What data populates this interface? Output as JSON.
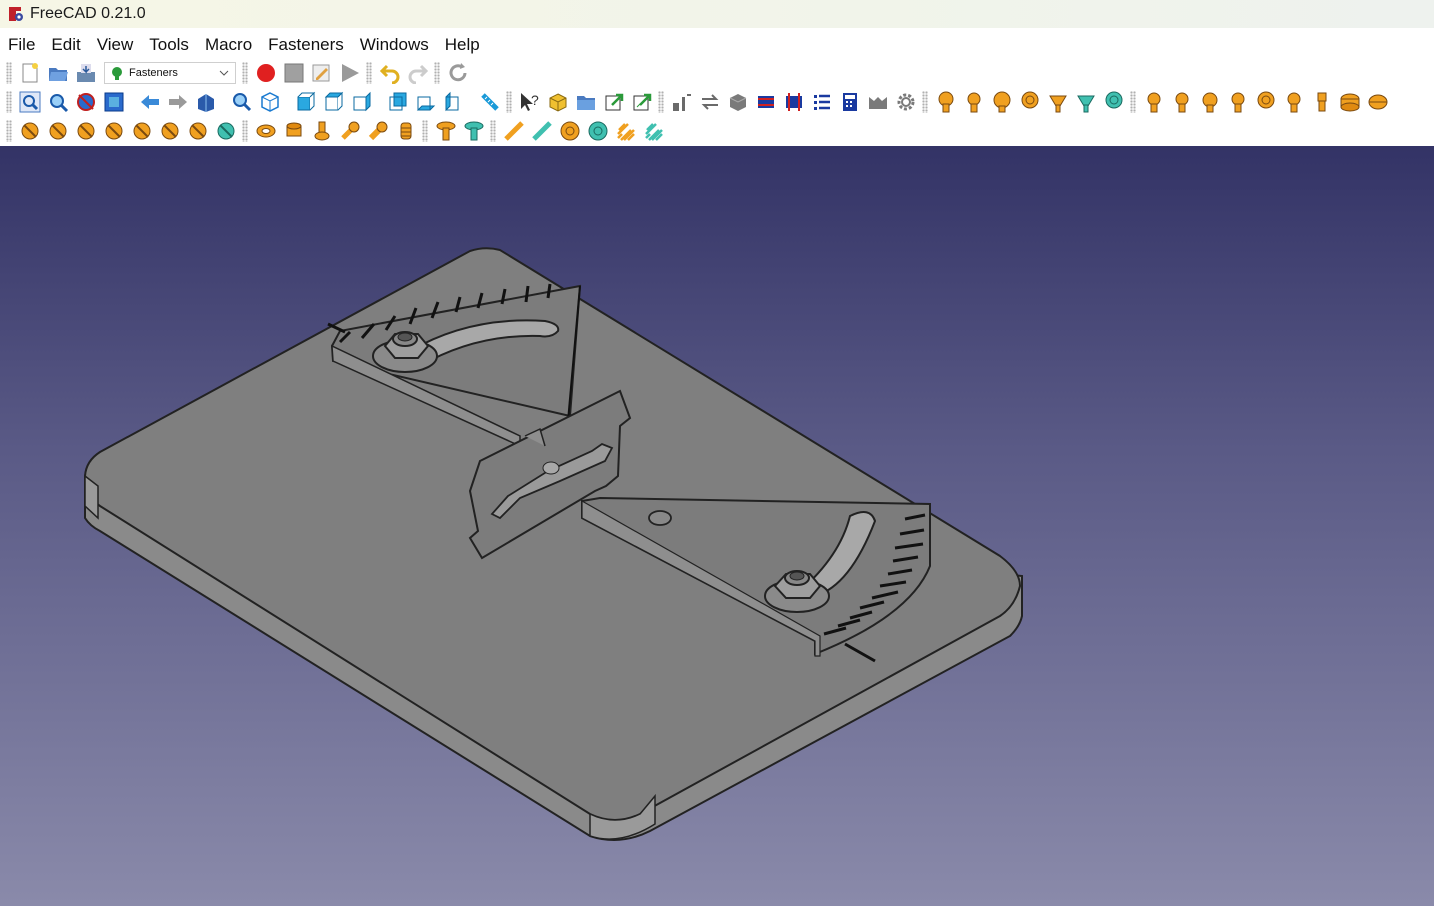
{
  "window": {
    "title": "FreeCAD 0.21.0"
  },
  "menu": {
    "items": [
      "File",
      "Edit",
      "View",
      "Tools",
      "Macro",
      "Fasteners",
      "Windows",
      "Help"
    ]
  },
  "toolbar": {
    "workbench_selector": {
      "value": "Fasteners"
    },
    "row1_buttons": [
      "new-file",
      "open-file",
      "save-file",
      "record-macro",
      "stop-macro",
      "edit-macro",
      "run-macro",
      "undo",
      "redo",
      "refresh"
    ],
    "row2_buttons": [
      "fit-all",
      "fit-selection",
      "draw-style",
      "bounding-box",
      "back",
      "forward",
      "sync-view",
      "zoom",
      "isometric-view",
      "front-view",
      "top-view",
      "right-view",
      "rear-view",
      "bottom-view",
      "left-view",
      "measure",
      "whats-this",
      "part",
      "group",
      "link",
      "link-actions",
      "stretch",
      "flip",
      "shape",
      "bolt-blue-a",
      "bolt-blue-b",
      "parts-list",
      "calculator",
      "m-icon",
      "settings"
    ],
    "row3_buttons": [
      "screw-1",
      "screw-2",
      "screw-3",
      "screw-4",
      "screw-5",
      "screw-6",
      "screw-7",
      "screw-8",
      "washer-1",
      "nut-1",
      "pin-1",
      "insert-1",
      "insert-2",
      "insert-3",
      "rivet-1",
      "rivet-2",
      "rod-1",
      "rod-2",
      "disc-1",
      "disc-2",
      "spring-1",
      "spring-2"
    ]
  },
  "colors": {
    "accent_orange": "#f0a020",
    "teal": "#40c0b0",
    "part_gray": "#7f7f7f",
    "viewport_top": "#333366",
    "viewport_bottom": "#8a8aaa"
  }
}
